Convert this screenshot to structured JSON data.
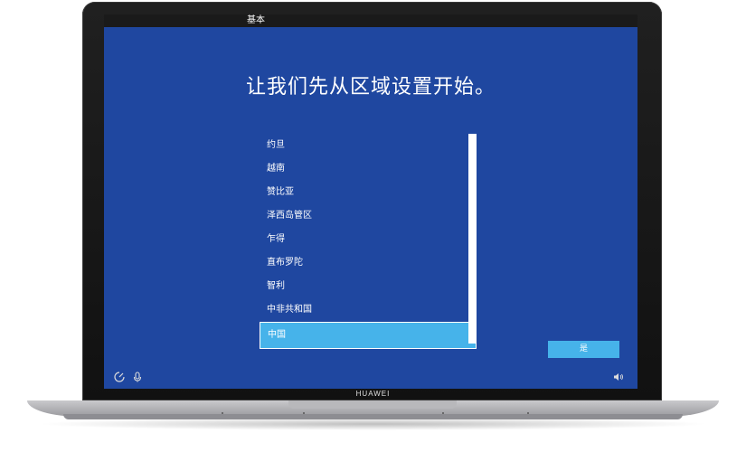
{
  "tabs": [
    {
      "label": "基本",
      "active": true
    }
  ],
  "headline": "让我们先从区域设置开始。",
  "region_list": {
    "items": [
      "约旦",
      "越南",
      "赞比亚",
      "泽西岛管区",
      "乍得",
      "直布罗陀",
      "智利",
      "中非共和国",
      "中国"
    ],
    "selected": "中国"
  },
  "buttons": {
    "yes_label": "是"
  },
  "device": {
    "brand": "HUAWEI"
  },
  "colors": {
    "screen_bg": "#1f47a0",
    "accent": "#46b3ea"
  }
}
